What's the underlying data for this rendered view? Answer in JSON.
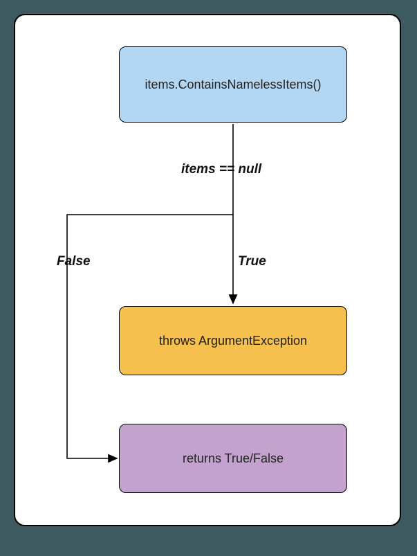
{
  "nodes": {
    "start": "items.ContainsNamelessItems()",
    "exception": "throws ArgumentException",
    "result": "returns True/False"
  },
  "labels": {
    "condition": "items == null",
    "true_branch": "True",
    "false_branch": "False"
  }
}
